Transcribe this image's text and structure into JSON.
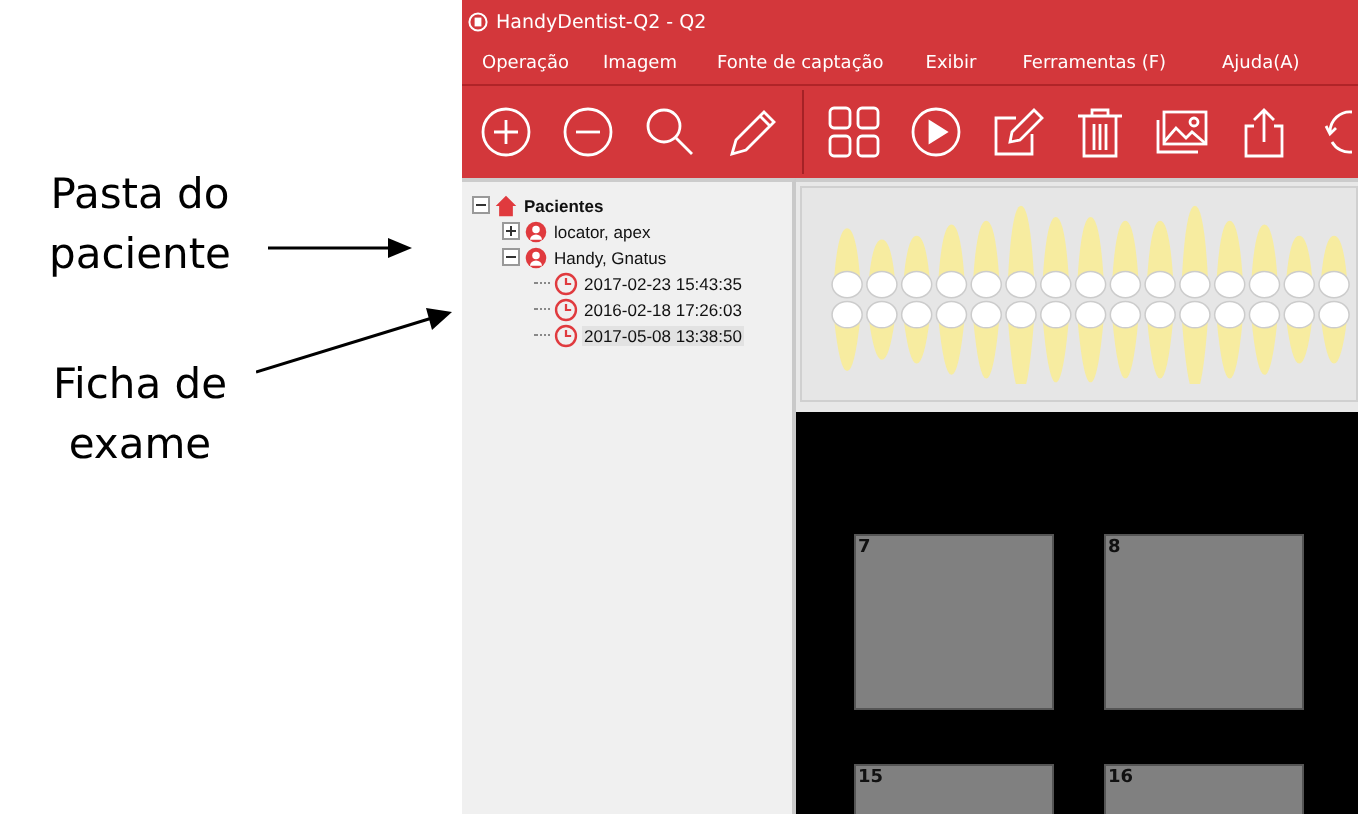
{
  "annotations": [
    {
      "text": "Pasta do paciente"
    },
    {
      "text": "Ficha de exame"
    }
  ],
  "window": {
    "title": "HandyDentist-Q2 - Q2"
  },
  "menu": [
    "Operação",
    "Imagem",
    "Fonte de captação",
    "Exibir",
    "Ferramentas (F)",
    "Ajuda(A)"
  ],
  "tree": [
    {
      "kind": "root",
      "label": "Pacientes",
      "expanded": true,
      "children": [
        {
          "kind": "patient",
          "label": "locator, apex",
          "expanded": false
        },
        {
          "kind": "patient",
          "label": "Handy, Gnatus",
          "expanded": true,
          "children": [
            {
              "kind": "exam",
              "label": "2017-02-23 15:43:35",
              "selected": false
            },
            {
              "kind": "exam",
              "label": "2016-02-18 17:26:03",
              "selected": false
            },
            {
              "kind": "exam",
              "label": "2017-05-08 13:38:50",
              "selected": true
            }
          ]
        }
      ]
    }
  ],
  "slots": [
    {
      "label": "7"
    },
    {
      "label": "8"
    },
    {
      "label": "15"
    },
    {
      "label": "16"
    }
  ]
}
